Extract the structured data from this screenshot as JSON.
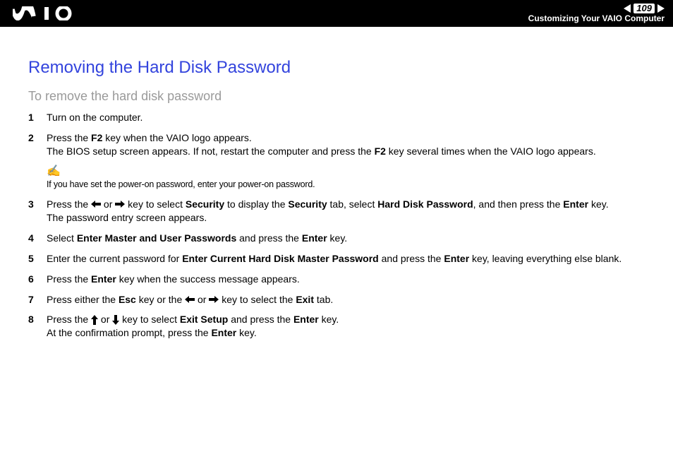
{
  "header": {
    "page_number": "109",
    "section": "Customizing Your VAIO Computer"
  },
  "title": "Removing the Hard Disk Password",
  "subtitle": "To remove the hard disk password",
  "steps": {
    "s1": "Turn on the computer.",
    "s2_a": "Press the ",
    "s2_b": " key when the VAIO logo appears.",
    "s2_c": "The BIOS setup screen appears. If not, restart the computer and press the ",
    "s2_d": " key several times when the VAIO logo appears.",
    "s2_key": "F2",
    "note": "If you have set the power-on password, enter your power-on password.",
    "s3_a": "Press the ",
    "s3_b": " or ",
    "s3_c": " key to select ",
    "s3_d": " to display the ",
    "s3_e": " tab, select ",
    "s3_f": ", and then press the ",
    "s3_g": " key.",
    "s3_h": "The password entry screen appears.",
    "s3_k1": "Security",
    "s3_k2": "Security",
    "s3_k3": "Hard Disk Password",
    "s3_k4": "Enter",
    "s4_a": "Select ",
    "s4_b": " and press the ",
    "s4_c": " key.",
    "s4_k1": "Enter Master and User Passwords",
    "s4_k2": "Enter",
    "s5_a": "Enter the current password for ",
    "s5_b": " and press the ",
    "s5_c": " key, leaving everything else blank.",
    "s5_k1": "Enter Current Hard Disk Master Password",
    "s5_k2": "Enter",
    "s6_a": "Press the ",
    "s6_b": " key when the success message appears.",
    "s6_k1": "Enter",
    "s7_a": "Press either the ",
    "s7_b": " key or the ",
    "s7_c": " or ",
    "s7_d": " key to select the ",
    "s7_e": " tab.",
    "s7_k1": "Esc",
    "s7_k2": "Exit",
    "s8_a": "Press the ",
    "s8_b": " or ",
    "s8_c": " key to select ",
    "s8_d": " and press the ",
    "s8_e": " key.",
    "s8_f": "At the confirmation prompt, press the ",
    "s8_g": " key.",
    "s8_k1": "Exit Setup",
    "s8_k2": "Enter",
    "s8_k3": "Enter"
  }
}
